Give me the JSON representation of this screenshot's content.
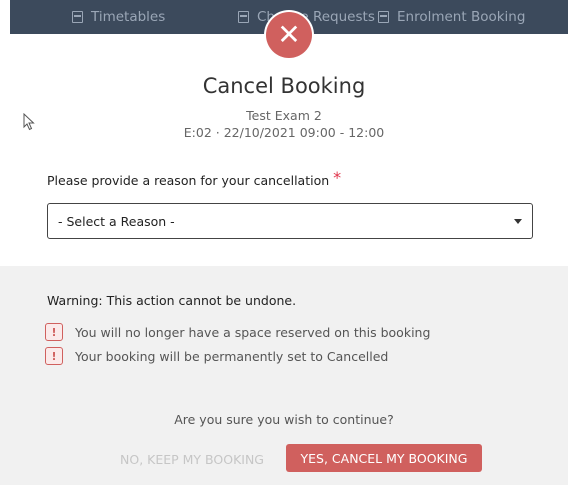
{
  "nav": {
    "items": [
      {
        "label": "Timetables",
        "icon": "calendar-icon"
      },
      {
        "label": "Change Requests",
        "icon": "document-icon"
      },
      {
        "label": "Enrolment Booking",
        "icon": "document-icon"
      }
    ]
  },
  "modal": {
    "close_icon": "close-icon",
    "close_glyph": "✕",
    "title": "Cancel Booking",
    "exam_name": "Test Exam 2",
    "exam_details": "E:02  ·  22/10/2021 09:00 - 12:00",
    "reason_label": "Please provide a reason for your cancellation",
    "required_marker": "*",
    "select": {
      "selected": "- Select a Reason -"
    },
    "warning_title": "Warning: This action cannot be undone.",
    "warnings": [
      "You will no longer have a space reserved on this booking",
      "Your booking will be permanently set to Cancelled"
    ],
    "warning_glyph": "!",
    "confirm_question": "Are you sure you wish to continue?",
    "keep_button": "NO, KEEP MY BOOKING",
    "cancel_button": "YES, CANCEL MY BOOKING"
  },
  "colors": {
    "accent": "#d0605e",
    "nav_bg": "#3c4a5c",
    "footer_bg": "#f1f1f1",
    "required": "#e0334a"
  }
}
